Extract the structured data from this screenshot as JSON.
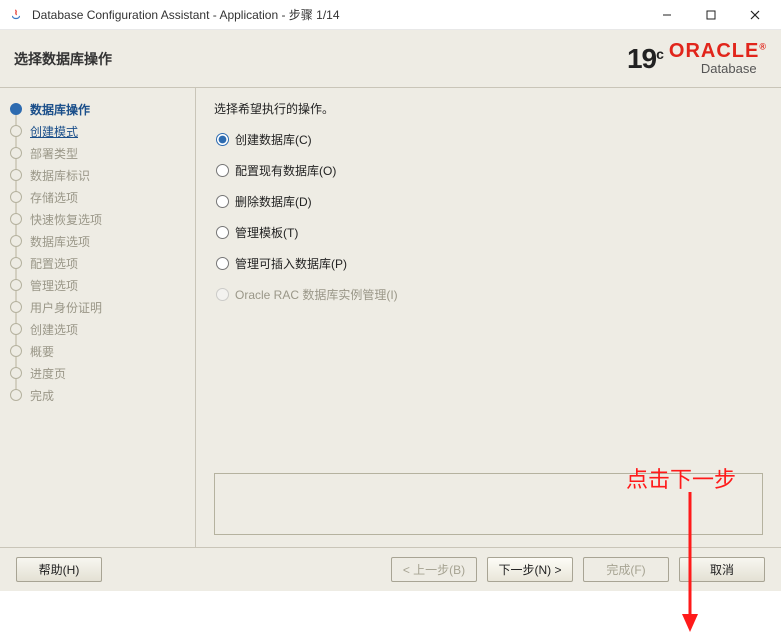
{
  "window": {
    "title": "Database Configuration Assistant - Application - 步骤 1/14"
  },
  "header": {
    "title": "选择数据库操作",
    "version": "19",
    "version_suffix": "c",
    "brand": "ORACLE",
    "sub_brand": "Database"
  },
  "sidebar": {
    "steps": [
      {
        "label": "数据库操作",
        "state": "active"
      },
      {
        "label": "创建模式",
        "state": "link"
      },
      {
        "label": "部署类型",
        "state": "disabled"
      },
      {
        "label": "数据库标识",
        "state": "disabled"
      },
      {
        "label": "存储选项",
        "state": "disabled"
      },
      {
        "label": "快速恢复选项",
        "state": "disabled"
      },
      {
        "label": "数据库选项",
        "state": "disabled"
      },
      {
        "label": "配置选项",
        "state": "disabled"
      },
      {
        "label": "管理选项",
        "state": "disabled"
      },
      {
        "label": "用户身份证明",
        "state": "disabled"
      },
      {
        "label": "创建选项",
        "state": "disabled"
      },
      {
        "label": "概要",
        "state": "disabled"
      },
      {
        "label": "进度页",
        "state": "disabled"
      },
      {
        "label": "完成",
        "state": "disabled"
      }
    ]
  },
  "main": {
    "prompt": "选择希望执行的操作。",
    "options": [
      {
        "label": "创建数据库(C)",
        "value": "create",
        "selected": true,
        "enabled": true
      },
      {
        "label": "配置现有数据库(O)",
        "value": "config",
        "selected": false,
        "enabled": true
      },
      {
        "label": "删除数据库(D)",
        "value": "delete",
        "selected": false,
        "enabled": true
      },
      {
        "label": "管理模板(T)",
        "value": "template",
        "selected": false,
        "enabled": true
      },
      {
        "label": "管理可插入数据库(P)",
        "value": "pdb",
        "selected": false,
        "enabled": true
      },
      {
        "label": "Oracle RAC 数据库实例管理(I)",
        "value": "rac",
        "selected": false,
        "enabled": false
      }
    ]
  },
  "annotation": {
    "text": "点击下一步"
  },
  "footer": {
    "help": "帮助(H)",
    "back": "< 上一步(B)",
    "next": "下一步(N) >",
    "finish": "完成(F)",
    "cancel": "取消"
  }
}
